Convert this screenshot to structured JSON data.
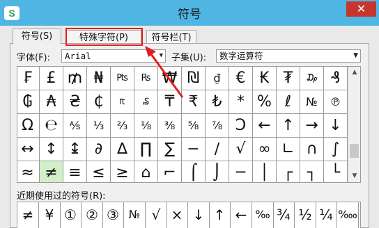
{
  "window": {
    "title": "符号",
    "logo_text": "S",
    "close_glyph": "✕"
  },
  "tabs": [
    {
      "label": "符号(S)",
      "active": true
    },
    {
      "label": "特殊字符(P)",
      "active": false
    },
    {
      "label": "符号栏(T)",
      "active": false
    }
  ],
  "font": {
    "label": "字体(F):",
    "value": "Arial"
  },
  "subset": {
    "label": "子集(U):",
    "value": "数字运算符"
  },
  "symbols": [
    [
      "₣",
      "£",
      "₥",
      "₦",
      "₧",
      "₨",
      "₩",
      "₪",
      "₫",
      "€",
      "₭",
      "₮",
      "₯",
      "₰",
      "₱"
    ],
    [
      "₲",
      "₳",
      "₴",
      "₵",
      "₶",
      "₷",
      "₸",
      "₹",
      "₺",
      "*",
      "%",
      "ℓ",
      "№",
      "℗",
      "™"
    ],
    [
      "Ω",
      "℮",
      "⅍",
      "⅓",
      "⅔",
      "⅛",
      "⅜",
      "⅝",
      "⅞",
      "Ↄ",
      "←",
      "↑",
      "→",
      "↓"
    ],
    [
      "↔",
      "↕",
      "↨",
      "∂",
      "∆",
      "∏",
      "∑",
      "−",
      "∕",
      "√",
      "∞",
      "∟",
      "∩",
      "∫"
    ],
    [
      "≈",
      "≠",
      "≡",
      "≤",
      "≥",
      "⌂",
      "⌐",
      "⌠",
      "⌡",
      "─",
      "│",
      "┌",
      "┐",
      "└"
    ]
  ],
  "selected_symbol": "≠",
  "recent": {
    "label": "近期使用过的符号(R):",
    "items": [
      "≠",
      "¥",
      "①",
      "②",
      "③",
      "№",
      "√",
      "×",
      "↓",
      "↑",
      "←",
      "‰",
      "¾",
      "½",
      "¼",
      "‱"
    ]
  },
  "colors": {
    "titlebar": "#4fb6e4",
    "close": "#c6362e",
    "highlight": "#e01f1f",
    "selected": "#d2f0c8"
  }
}
